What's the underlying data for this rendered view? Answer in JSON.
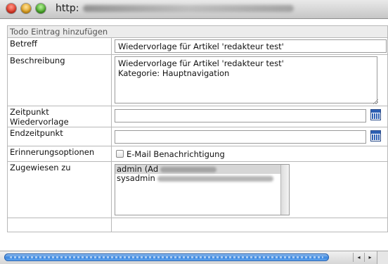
{
  "window": {
    "url_prefix": "http:"
  },
  "form": {
    "title": "Todo Eintrag hinzufügen",
    "fields": {
      "subject": {
        "label": "Betreff",
        "value": "Wiedervorlage für Artikel 'redakteur test'"
      },
      "description": {
        "label": "Beschreibung",
        "value": "Wiedervorlage für Artikel 'redakteur test'\nKategorie: Hauptnavigation"
      },
      "resubmission": {
        "label": "Zeitpunkt Wiedervorlage",
        "value": ""
      },
      "end_time": {
        "label": "Endzeitpunkt",
        "value": ""
      },
      "reminder": {
        "label": "Erinnerungsoptionen",
        "option_label": "E-Mail Benachrichtigung",
        "checked": false
      },
      "assigned_to": {
        "label": "Zugewiesen zu",
        "options": [
          "admin (Ad",
          "sysadmin"
        ],
        "selected_index": 0
      }
    }
  },
  "icons": {
    "calendar": "calendar-icon",
    "scroll_left": "◂",
    "scroll_right": "▸"
  }
}
